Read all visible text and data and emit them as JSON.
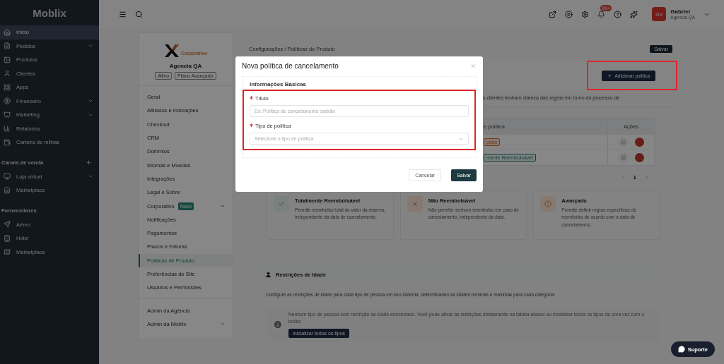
{
  "sidebar": {
    "logo": "Moblix",
    "groups": [
      {
        "items": [
          {
            "label": "Início",
            "selected": true,
            "expandable": false
          },
          {
            "label": "Pedidos",
            "selected": false,
            "expandable": true
          },
          {
            "label": "Produtos",
            "selected": false,
            "expandable": false
          },
          {
            "label": "Clientes",
            "selected": false,
            "expandable": false
          },
          {
            "label": "Apps",
            "selected": false,
            "expandable": false
          },
          {
            "label": "Financeiro",
            "selected": false,
            "expandable": true
          },
          {
            "label": "Marketing",
            "selected": false,
            "expandable": true
          },
          {
            "label": "Relatórios",
            "selected": false,
            "expandable": false
          },
          {
            "label": "Carteira de milhas",
            "selected": false,
            "expandable": false
          }
        ]
      },
      {
        "title": "Canais de venda",
        "addable": true,
        "items": [
          {
            "label": "Loja virtual",
            "selected": false,
            "expandable": true
          },
          {
            "label": "Marketplace",
            "selected": false,
            "expandable": false
          }
        ]
      },
      {
        "title": "Fornecedores",
        "addable": false,
        "items": [
          {
            "label": "Aéreo",
            "selected": false,
            "expandable": false
          },
          {
            "label": "Hotel",
            "selected": false,
            "expandable": false
          },
          {
            "label": "Marketplace",
            "selected": false,
            "expandable": false
          }
        ]
      }
    ]
  },
  "header": {
    "notification_badge": "99+",
    "user": {
      "initials": "GV",
      "name": "Gabriel",
      "org": "Agencia QA"
    }
  },
  "settings_panel": {
    "brand": "Corporativo",
    "org": "Agencia QA",
    "tags": [
      "Ativo",
      "Plano Avançado"
    ],
    "groups": [
      [
        {
          "label": "Geral",
          "selected": false,
          "expandable": false
        },
        {
          "label": "Afiliados e Indicações",
          "selected": false,
          "expandable": false
        },
        {
          "label": "Checkout",
          "selected": false,
          "expandable": false
        },
        {
          "label": "CRM",
          "selected": false,
          "expandable": false
        },
        {
          "label": "Domínios",
          "selected": false,
          "expandable": false
        },
        {
          "label": "Idiomas e Moedas",
          "selected": false,
          "expandable": false
        },
        {
          "label": "Integrações",
          "selected": false,
          "expandable": false
        },
        {
          "label": "Legal e Sobre",
          "selected": false,
          "expandable": false
        },
        {
          "label": "Corporativo",
          "badge": "Novo",
          "selected": false,
          "expandable": true
        },
        {
          "label": "Notificações",
          "selected": false,
          "expandable": false
        },
        {
          "label": "Pagamentos",
          "selected": false,
          "expandable": false
        },
        {
          "label": "Planos e Faturas",
          "selected": false,
          "expandable": false
        },
        {
          "label": "Políticas de Produto",
          "selected": true,
          "expandable": false
        },
        {
          "label": "Preferências do Site",
          "selected": false,
          "expandable": false
        },
        {
          "label": "Usuários e Permissões",
          "selected": false,
          "expandable": false
        }
      ],
      [
        {
          "label": "Admin da Agência",
          "selected": false,
          "expandable": false
        },
        {
          "label": "Admin da Moblix",
          "selected": false,
          "expandable": true
        }
      ]
    ]
  },
  "page": {
    "breadcrumb": "Configurações / Políticas de Produto",
    "save_button": "Salvar",
    "add_button": "Adicionar política",
    "description": "s clientes tenham clareza das regras em torno do processo de",
    "table": {
      "columns": [
        "e política",
        "Ações"
      ],
      "rows": [
        {
          "type": "çado",
          "kind": "warning"
        },
        {
          "type": "mente Reembolsável",
          "kind": "success"
        }
      ]
    },
    "pagination": {
      "page": "1"
    },
    "policy_types": [
      {
        "kind": "full",
        "title": "Totalmente Reembolsável",
        "text": "Permite reembolso total do valor da reserva, independente da data de cancelamento."
      },
      {
        "kind": "none",
        "title": "Não Reembolsável",
        "text": "Não permite nenhum reembolso em caso de cancelamento, independente da data."
      },
      {
        "kind": "advanced",
        "title": "Avançado",
        "text": "Permite definir regras específicas de reembolso de acordo com a data de cancelamento."
      }
    ],
    "age_restrictions": {
      "title": "Restrições de Idade",
      "description": "Configure as restrições de idade para cada tipo de pessoa em seu sistema, determinando as idades mínimas e máximas para cada categoria.",
      "notice": "Nenhum tipo de pessoa com restrição de idade encontrado. Você pode ativar as restrições diretamente na tabela abaixo ou inicializar todos os tipos de uma vez com o botão:",
      "button": "Inicializar todos os tipos"
    },
    "support_button": "Suporte"
  },
  "modal": {
    "title": "Nova política de cancelamento",
    "section": "Informações Básicas",
    "fields": [
      {
        "kind": "text",
        "label": "Título",
        "required": true,
        "placeholder": "Ex: Política de cancelamento padrão"
      },
      {
        "kind": "select",
        "label": "Tipo de política",
        "required": true,
        "placeholder": "Selecione o tipo de política"
      }
    ],
    "cancel_button": "Cancelar",
    "save_button": "Salvar"
  }
}
